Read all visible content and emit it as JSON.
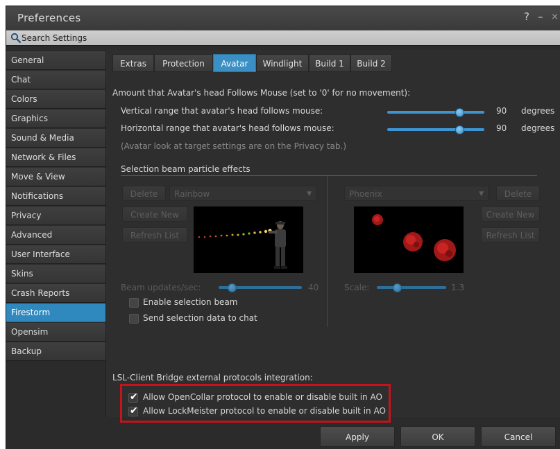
{
  "window": {
    "title": "Preferences",
    "help": "?",
    "minimize": "–",
    "close": "×"
  },
  "search": {
    "placeholder": "Search Settings"
  },
  "sidebar": {
    "items": [
      {
        "label": "General"
      },
      {
        "label": "Chat"
      },
      {
        "label": "Colors"
      },
      {
        "label": "Graphics"
      },
      {
        "label": "Sound & Media"
      },
      {
        "label": "Network & Files"
      },
      {
        "label": "Move & View"
      },
      {
        "label": "Notifications"
      },
      {
        "label": "Privacy"
      },
      {
        "label": "Advanced"
      },
      {
        "label": "User Interface"
      },
      {
        "label": "Skins"
      },
      {
        "label": "Crash Reports"
      },
      {
        "label": "Firestorm"
      },
      {
        "label": "Opensim"
      },
      {
        "label": "Backup"
      }
    ],
    "active_index": 13
  },
  "tabs": [
    {
      "label": "Extras"
    },
    {
      "label": "Protection"
    },
    {
      "label": "Avatar"
    },
    {
      "label": "Windlight"
    },
    {
      "label": "Build 1"
    },
    {
      "label": "Build 2"
    }
  ],
  "active_tab": "Avatar",
  "head_follow": {
    "heading": "Amount that Avatar's head Follows Mouse (set to '0' for no movement):",
    "vertical": {
      "label": "Vertical range that avatar's head follows mouse:",
      "value": "90",
      "unit": "degrees",
      "level": 0.75
    },
    "horizontal": {
      "label": "Horizontal range that avatar's head follows mouse:",
      "value": "90",
      "unit": "degrees",
      "level": 0.75
    },
    "note": "(Avatar look at target settings are on the Privacy tab.)"
  },
  "beam": {
    "heading": "Selection beam particle effects",
    "left": {
      "delete_label": "Delete",
      "combo_value": "Rainbow",
      "create_label": "Create New",
      "refresh_label": "Refresh List",
      "updates_label": "Beam updates/sec:",
      "updates_value": "40",
      "updates_level": 0.15
    },
    "right": {
      "combo_value": "Phoenix",
      "delete_label": "Delete",
      "create_label": "Create New",
      "refresh_label": "Refresh List",
      "scale_label": "Scale:",
      "scale_value": "1.3",
      "scale_level": 0.3
    },
    "enable_label": "Enable selection beam",
    "send_label": "Send selection data to chat"
  },
  "lsl": {
    "heading": "LSL-Client Bridge external protocols integration:",
    "opencollar_label": "Allow OpenCollar protocol to enable or disable built in AO",
    "lockmeister_label": "Allow LockMeister protocol to enable or disable built in AO"
  },
  "footer": {
    "apply": "Apply",
    "ok": "OK",
    "cancel": "Cancel"
  },
  "colors": {
    "accent": "#2f88be",
    "highlight": "#c8121a"
  }
}
